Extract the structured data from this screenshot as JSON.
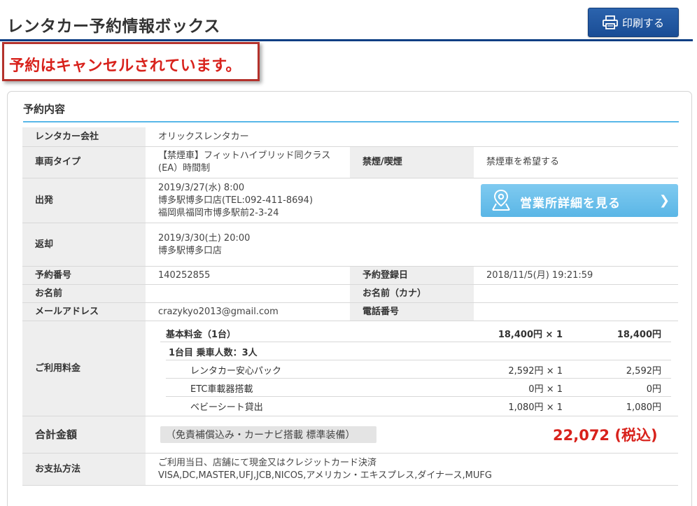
{
  "header": {
    "title": "レンタカー予約情報ボックス",
    "print_label": "印刷する"
  },
  "cancel_notice": "予約はキャンセルされています。",
  "panel": {
    "title": "予約内容"
  },
  "rows": {
    "company_label": "レンタカー会社",
    "company_value": "オリックスレンタカー",
    "car_type_label": "車両タイプ",
    "car_type_value_1": "【禁煙車】フィットハイブリッド同クラス",
    "car_type_value_2": "(EA）時間制",
    "smoking_label": "禁煙/喫煙",
    "smoking_value": "禁煙車を希望する",
    "departure_label": "出発",
    "departure_line_1": "2019/3/27(水) 8:00",
    "departure_line_2": "博多駅博多口店(TEL:092-411-8694)",
    "departure_line_3": "福岡県福岡市博多駅前2-3-24",
    "store_button_label": "営業所詳細を見る",
    "return_label": "返却",
    "return_line_1": "2019/3/30(土) 20:00",
    "return_line_2": "博多駅博多口店",
    "reservation_no_label": "予約番号",
    "reservation_no_value": "140252855",
    "registered_label": "予約登録日",
    "registered_value": "2018/11/5(月) 19:21:59",
    "name_label": "お名前",
    "name_value": "",
    "name_kana_label": "お名前（カナ）",
    "name_kana_value": "",
    "email_label": "メールアドレス",
    "email_value": "crazykyo2013@gmail.com",
    "phone_label": "電話番号",
    "phone_value": "",
    "fee_label": "ご利用料金",
    "total_label": "合計金額",
    "total_note": "（免責補償込み・カーナビ搭載 標準装備）",
    "total_amount": "22,072 (税込)",
    "payment_label": "お支払方法",
    "payment_line_1": "ご利用当日、店舗にて現金又はクレジットカード決済",
    "payment_line_2": "VISA,DC,MASTER,UFJ,JCB,NICOS,アメリカン・エキスプレス,ダイナース,MUFG"
  },
  "fees": {
    "base_label": "基本料金（1台）",
    "base_unit": "18,400円 × 1",
    "base_total": "18,400円",
    "day_label": "1台目 乗車人数：3人",
    "items": [
      {
        "label": "レンタカー安心パック",
        "unit": "2,592円 × 1",
        "total": "2,592円"
      },
      {
        "label": "ETC車載器搭載",
        "unit": "0円 × 1",
        "total": "0円"
      },
      {
        "label": "ベビーシート貸出",
        "unit": "1,080円 × 1",
        "total": "1,080円"
      }
    ]
  },
  "colors": {
    "accent_blue": "#0c3e84",
    "cancel_red": "#d8221c",
    "section_rule": "#58b7e8"
  }
}
